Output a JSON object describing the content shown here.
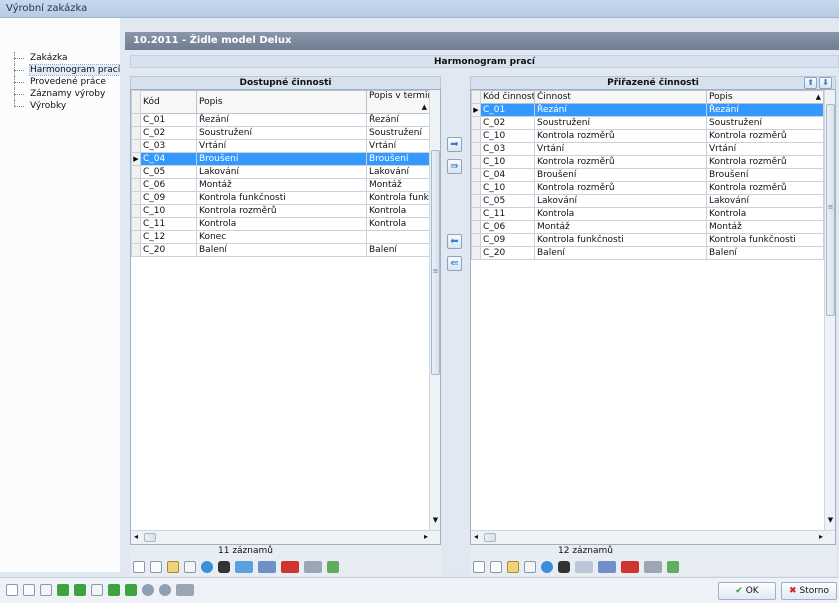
{
  "window": {
    "title": "Výrobní zakázka"
  },
  "sidebar": {
    "items": [
      {
        "label": "Zakázka"
      },
      {
        "label": "Harmonogram prací"
      },
      {
        "label": "Provedené práce"
      },
      {
        "label": "Záznamy výroby"
      },
      {
        "label": "Výrobky"
      }
    ]
  },
  "header": {
    "title": "10.2011  -  Židle model Delux"
  },
  "section": {
    "title": "Harmonogram prací"
  },
  "available": {
    "title": "Dostupné činnosti",
    "columns": [
      "Kód",
      "Popis",
      "Popis v termin"
    ],
    "rows": [
      [
        "C_01",
        "Řezání",
        "Řezání"
      ],
      [
        "C_02",
        "Soustružení",
        "Soustružení"
      ],
      [
        "C_03",
        "Vrtání",
        "Vrtání"
      ],
      [
        "C_04",
        "Broušení",
        "Broušení"
      ],
      [
        "C_05",
        "Lakování",
        "Lakování"
      ],
      [
        "C_06",
        "Montáž",
        "Montáž"
      ],
      [
        "C_09",
        "Kontrola funkčnosti",
        "Kontrola funkč"
      ],
      [
        "C_10",
        "Kontrola rozměrů",
        "Kontrola"
      ],
      [
        "C_11",
        "Kontrola",
        "Kontrola"
      ],
      [
        "C_12",
        "Konec",
        ""
      ],
      [
        "C_20",
        "Balení",
        "Balení"
      ]
    ],
    "selected_row": 3,
    "count": "11 záznamů"
  },
  "assigned": {
    "title": "Přiřazené činnosti",
    "columns": [
      "Kód činnosti",
      "Činnost",
      "Popis"
    ],
    "rows": [
      [
        "C_01",
        "Řezání",
        "Řezání"
      ],
      [
        "C_02",
        "Soustružení",
        "Soustružení"
      ],
      [
        "C_10",
        "Kontrola rozměrů",
        "Kontrola rozměrů"
      ],
      [
        "C_03",
        "Vrtání",
        "Vrtání"
      ],
      [
        "C_10",
        "Kontrola rozměrů",
        "Kontrola rozměrů"
      ],
      [
        "C_04",
        "Broušení",
        "Broušení"
      ],
      [
        "C_10",
        "Kontrola rozměrů",
        "Kontrola rozměrů"
      ],
      [
        "C_05",
        "Lakování",
        "Lakování"
      ],
      [
        "C_11",
        "Kontrola",
        "Kontrola"
      ],
      [
        "C_06",
        "Montáž",
        "Montáž"
      ],
      [
        "C_09",
        "Kontrola funkčnosti",
        "Kontrola funkčnosti"
      ],
      [
        "C_20",
        "Balení",
        "Balení"
      ]
    ],
    "selected_row": 0,
    "count": "12 záznamů"
  },
  "buttons": {
    "ok": "OK",
    "cancel": "Storno"
  },
  "colors": {
    "selection": "#3399ff",
    "header_bar": "#7b889c"
  }
}
